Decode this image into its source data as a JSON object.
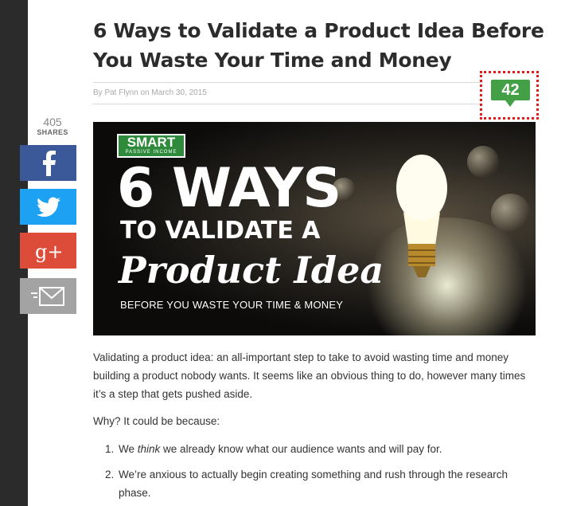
{
  "article": {
    "title": "6 Ways to Validate a Product Idea Before You Waste Your Time and Money",
    "byline": "By Pat Flynn on March 30, 2015",
    "comment_count": "42"
  },
  "share": {
    "count": "405",
    "label": "SHARES",
    "buttons": [
      {
        "network": "facebook",
        "icon": "facebook-icon",
        "color": "#3b5998"
      },
      {
        "network": "twitter",
        "icon": "twitter-icon",
        "color": "#1da1f2"
      },
      {
        "network": "google-plus",
        "icon": "google-plus-icon",
        "color": "#dd4b39"
      },
      {
        "network": "email",
        "icon": "email-icon",
        "color": "#a3a3a3"
      }
    ]
  },
  "hero": {
    "badge": "SMART",
    "badge_sub": "PASSIVE INCOME",
    "line1": "6 WAYS",
    "line2": "TO VALIDATE A",
    "line3": "Product Idea",
    "line4": "BEFORE YOU WASTE YOUR TIME & MONEY"
  },
  "body": {
    "p1": "Validating a product idea: an all-important step to take to avoid wasting time and money building a product nobody wants. It seems like an obvious thing to do, however many times it’s a step that gets pushed aside.",
    "p2": "Why? It could be because:",
    "list": [
      {
        "num": "1.",
        "pre": "We ",
        "em": "think",
        "post": " we already know what our audience wants and will pay for."
      },
      {
        "num": "2.",
        "pre": "We’re anxious to actually begin creating something and rush through the research phase.",
        "em": "",
        "post": ""
      }
    ]
  },
  "colors": {
    "accent_green": "#43a047",
    "highlight_red": "#e21b1b"
  }
}
